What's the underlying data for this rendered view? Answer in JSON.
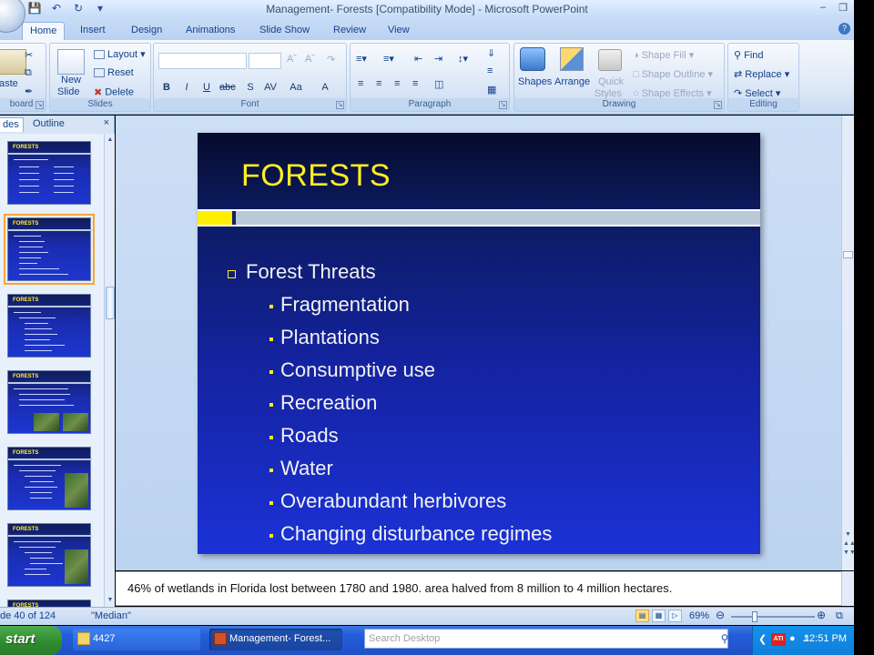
{
  "window": {
    "title": "Management- Forests [Compatibility Mode] - Microsoft PowerPoint",
    "qat_icons": [
      "save-icon",
      "undo-icon",
      "redo-icon",
      "customize-icon"
    ]
  },
  "tabs": [
    "Home",
    "Insert",
    "Design",
    "Animations",
    "Slide Show",
    "Review",
    "View"
  ],
  "active_tab": "Home",
  "ribbon": {
    "clipboard": {
      "paste": "aste",
      "label": "board"
    },
    "slides": {
      "new_slide_1": "New",
      "new_slide_2": "Slide",
      "layout": "Layout",
      "reset": "Reset",
      "delete": "Delete",
      "label": "Slides"
    },
    "font": {
      "label": "Font",
      "font_name": "",
      "font_size": ""
    },
    "paragraph": {
      "label": "Paragraph"
    },
    "drawing": {
      "shapes": "Shapes",
      "arrange": "Arrange",
      "quick_styles_1": "Quick",
      "quick_styles_2": "Styles",
      "shape_fill": "Shape Fill",
      "shape_outline": "Shape Outline",
      "shape_effects": "Shape Effects",
      "label": "Drawing"
    },
    "editing": {
      "find": "Find",
      "replace": "Replace",
      "select": "Select",
      "label": "Editing"
    }
  },
  "left_pane": {
    "tab_slides": "des",
    "tab_outline": "Outline",
    "thumbnail_title": "FORESTS"
  },
  "slide": {
    "title": "FORESTS",
    "bullet": "Forest Threats",
    "sub_items": [
      "Fragmentation",
      "Plantations",
      "Consumptive use",
      "Recreation",
      "Roads",
      "Water",
      "Overabundant herbivores",
      "Changing disturbance regimes"
    ]
  },
  "notes": "46% of wetlands in Florida lost between 1780 and 1980.  area halved from 8 million to 4 million hectares.",
  "status": {
    "slide_position": "de 40 of 124",
    "theme": "\"Median\"",
    "zoom": "69%"
  },
  "taskbar": {
    "start": "start",
    "folder": "4427",
    "app": "Management- Forest...",
    "search_placeholder": "Search Desktop",
    "clock": "12:51 PM"
  },
  "colors": {
    "slide_title": "#ffee22",
    "slide_text": "#f2f2f2",
    "slide_bg_top": "#050b2c",
    "slide_bg_bottom": "#1b32d6",
    "ribbon_text": "#15428b"
  }
}
